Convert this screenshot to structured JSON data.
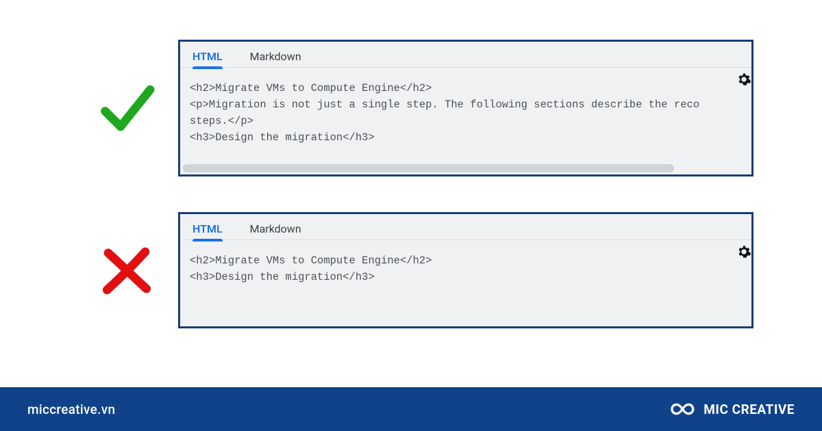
{
  "tabs": {
    "html": "HTML",
    "markdown": "Markdown"
  },
  "good": {
    "code": "<h2>Migrate VMs to Compute Engine</h2>\n<p>Migration is not just a single step. The following sections describe the reco\nsteps.</p>\n<h3>Design the migration</h3>"
  },
  "bad": {
    "code": "<h2>Migrate VMs to Compute Engine</h2>\n<h3>Design the migration</h3>"
  },
  "footer": {
    "site": "miccreative.vn",
    "brand": "MIC CREATIVE"
  }
}
